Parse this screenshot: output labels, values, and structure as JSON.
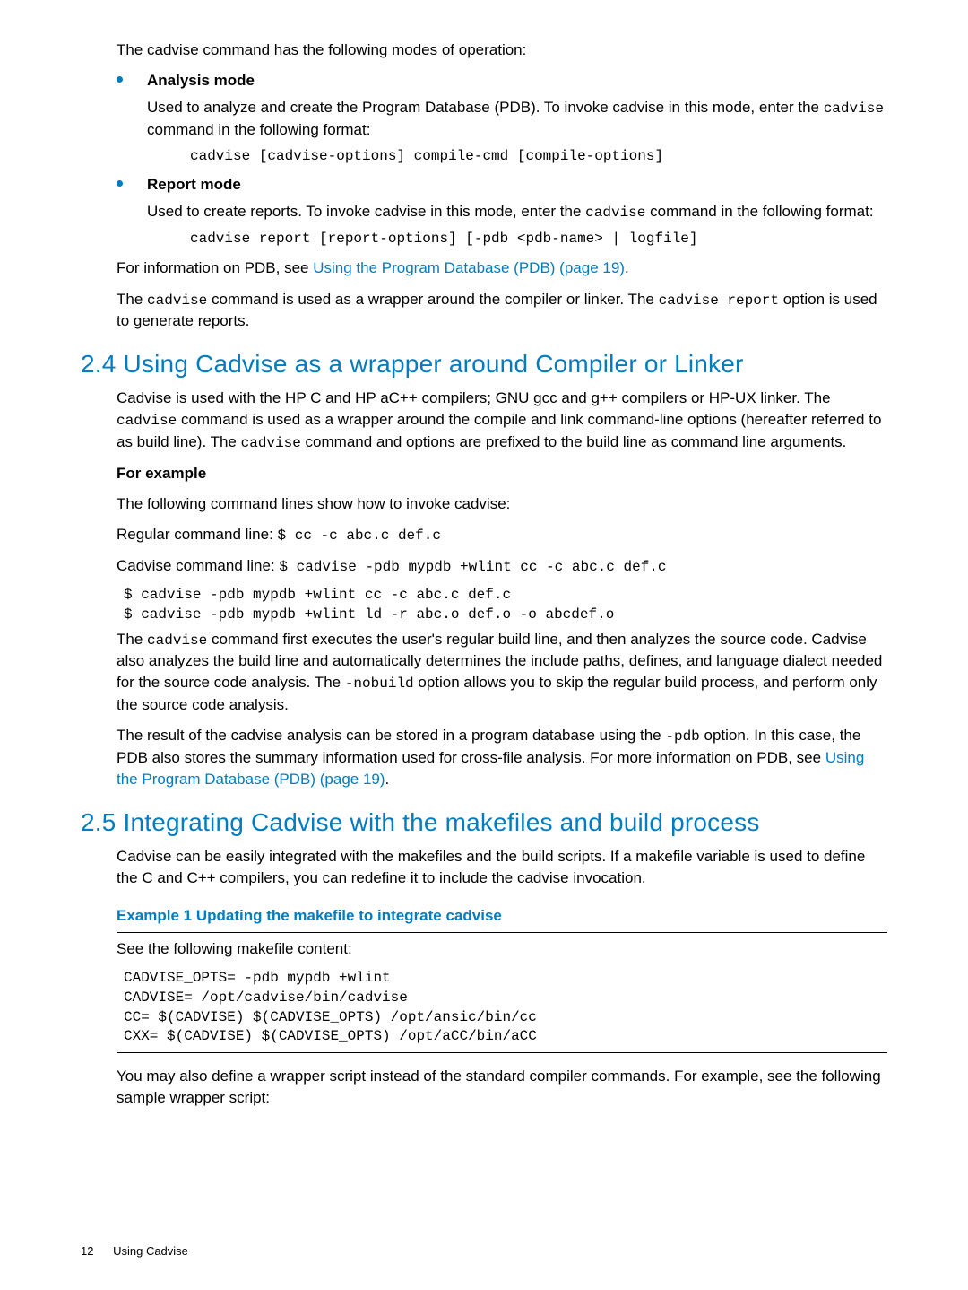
{
  "intro": {
    "modes_lead": "The cadvise command has the following modes of operation:"
  },
  "modes": {
    "analysis": {
      "title": "Analysis mode",
      "para_pre": "Used to analyze and create the Program Database (PDB). To invoke cadvise in this mode, enter the ",
      "para_code": "cadvise",
      "para_post": " command in the following format:",
      "command": "cadvise [cadvise-options] compile-cmd [compile-options]"
    },
    "report": {
      "title": "Report mode",
      "para_pre": "Used to create reports. To invoke cadvise in this mode, enter the ",
      "para_code": "cadvise",
      "para_post": " command in the following format:",
      "command": "cadvise report [report-options] [-pdb <pdb-name> | logfile]"
    }
  },
  "pdb_info": {
    "pre": "For information on PDB, see ",
    "link": "Using the Program Database (PDB) (page 19)",
    "post": "."
  },
  "wrapper_sentence": {
    "pre": "The ",
    "c1": "cadvise",
    "mid": " command is used as a wrapper around the compiler or linker. The ",
    "c2": "cadvise report",
    "post": " option is used to generate reports."
  },
  "section24": {
    "title": "2.4 Using Cadvise as a wrapper around Compiler or Linker",
    "para1": {
      "p1": "Cadvise is used with the HP C and HP aC++ compilers; GNU gcc and g++ compilers or HP-UX linker. The ",
      "c1": "cadvise",
      "p2": " command is used as a wrapper around the compile and link command-line options (hereafter referred to as build line). The ",
      "c2": "cadvise",
      "p3": " command and options are prefixed to the build line as command line arguments."
    },
    "for_example": "For example",
    "cmd_intro": "The following command lines show how to invoke cadvise:",
    "regular_label": "Regular command line: ",
    "regular_cmd": "$ cc -c abc.c def.c",
    "cadvise_label": "Cadvise command line: ",
    "cadvise_cmd": "$ cadvise -pdb mypdb +wlint cc -c abc.c def.c",
    "block_cmds": "$ cadvise -pdb mypdb +wlint cc -c abc.c def.c\n$ cadvise -pdb mypdb +wlint ld -r abc.o def.o -o abcdef.o",
    "para2": {
      "p1": "The ",
      "c1": "cadvise",
      "p2": " command first executes the user's regular build line, and then analyzes the source code. Cadvise also analyzes the build line and automatically determines the include paths, defines, and language dialect needed for the source code analysis. The ",
      "c2": "-nobuild",
      "p3": " option allows you to skip the regular build process, and perform only the source code analysis."
    },
    "para3": {
      "p1": "The result of the cadvise analysis can be stored in a program database using the ",
      "c1": "-pdb",
      "p2": " option. In this case, the PDB also stores the summary information used for cross-file analysis. For more information on PDB, see ",
      "link": "Using the Program Database (PDB) (page 19)",
      "p3": "."
    }
  },
  "section25": {
    "title": "2.5 Integrating Cadvise with the makefiles and build process",
    "para1": "Cadvise can be easily integrated with the makefiles and the build scripts. If a makefile variable is used to define the C and C++ compilers, you can redefine it to include the cadvise invocation.",
    "example_title": "Example 1 Updating the makefile to integrate cadvise",
    "see_following": "See the following makefile content:",
    "makefile": "CADVISE_OPTS= -pdb mypdb +wlint\nCADVISE= /opt/cadvise/bin/cadvise\nCC= $(CADVISE) $(CADVISE_OPTS) /opt/ansic/bin/cc\nCXX= $(CADVISE) $(CADVISE_OPTS) /opt/aCC/bin/aCC",
    "para2": "You may also define a wrapper script instead of the standard compiler commands. For example, see the following sample wrapper script:"
  },
  "footer": {
    "page_number": "12",
    "section": "Using Cadvise"
  }
}
